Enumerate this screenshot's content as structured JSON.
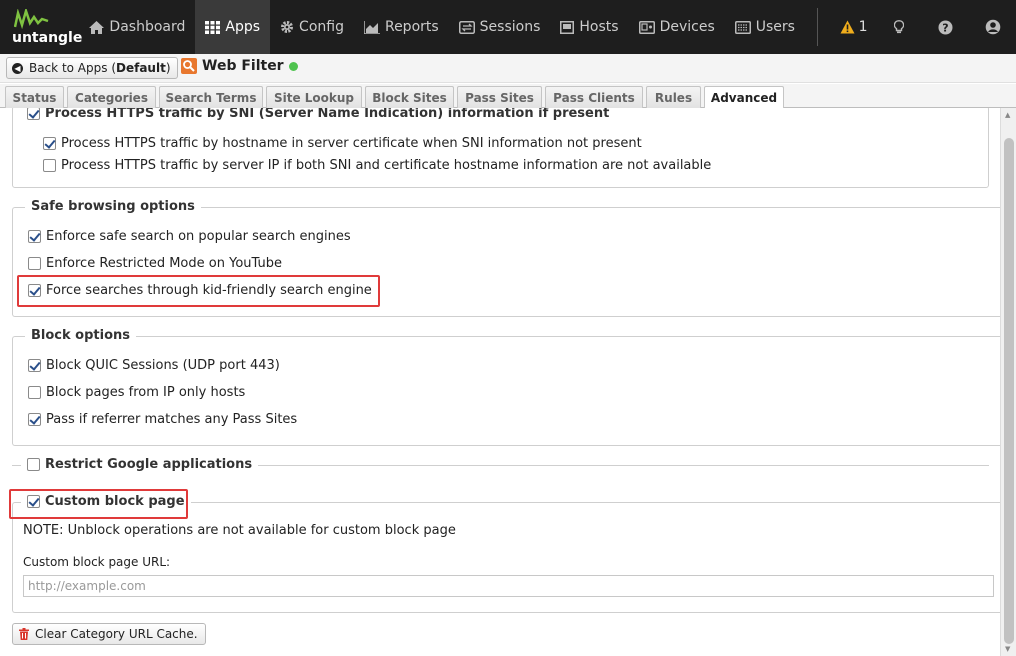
{
  "nav": {
    "logo_text": "untangle",
    "items": [
      {
        "label": "Dashboard",
        "icon": "home-icon"
      },
      {
        "label": "Apps",
        "icon": "apps-grid-icon"
      },
      {
        "label": "Config",
        "icon": "gear-icon"
      },
      {
        "label": "Reports",
        "icon": "area-chart-icon"
      },
      {
        "label": "Sessions",
        "icon": "sessions-icon"
      },
      {
        "label": "Hosts",
        "icon": "hosts-icon"
      },
      {
        "label": "Devices",
        "icon": "devices-icon"
      },
      {
        "label": "Users",
        "icon": "users-icon"
      }
    ],
    "active": "Apps",
    "alert_count": "1"
  },
  "crumb": {
    "back_prefix": "Back to Apps (",
    "back_default": "Default",
    "back_suffix": ")",
    "app_title": "Web Filter",
    "status_color": "#4fc34f"
  },
  "tabs": [
    "Status",
    "Categories",
    "Search Terms",
    "Site Lookup",
    "Block Sites",
    "Pass Sites",
    "Pass Clients",
    "Rules",
    "Advanced"
  ],
  "active_tab": "Advanced",
  "https": {
    "legend": "Process HTTPS traffic by SNI (Server Name Indication) information if present",
    "legend_checked": true,
    "options": [
      {
        "label": "Process HTTPS traffic by hostname in server certificate when SNI information not present",
        "checked": true
      },
      {
        "label": "Process HTTPS traffic by server IP if both SNI and certificate hostname information are not available",
        "checked": false
      }
    ]
  },
  "safe_browsing": {
    "legend": "Safe browsing options",
    "options": [
      {
        "label": "Enforce safe search on popular search engines",
        "checked": true
      },
      {
        "label": "Enforce Restricted Mode on YouTube",
        "checked": false
      },
      {
        "label": "Force searches through kid-friendly search engine",
        "checked": true
      }
    ]
  },
  "block_options": {
    "legend": "Block options",
    "options": [
      {
        "label": "Block QUIC Sessions (UDP port 443)",
        "checked": true
      },
      {
        "label": "Block pages from IP only hosts",
        "checked": false
      },
      {
        "label": "Pass if referrer matches any Pass Sites",
        "checked": true
      }
    ]
  },
  "google_apps": {
    "label": "Restrict Google applications",
    "checked": false
  },
  "custom_block": {
    "label": "Custom block page",
    "checked": true,
    "note": "NOTE: Unblock operations are not available for custom block page",
    "url_label": "Custom block page URL:",
    "url_placeholder": "http://example.com",
    "url_value": ""
  },
  "clear_cache_label": "Clear Category URL Cache.",
  "colors": {
    "highlight": "#e03a3a",
    "nav_bg": "#1e1e1e",
    "alert": "#f0ad1c",
    "app_icon": "#e8772e"
  }
}
